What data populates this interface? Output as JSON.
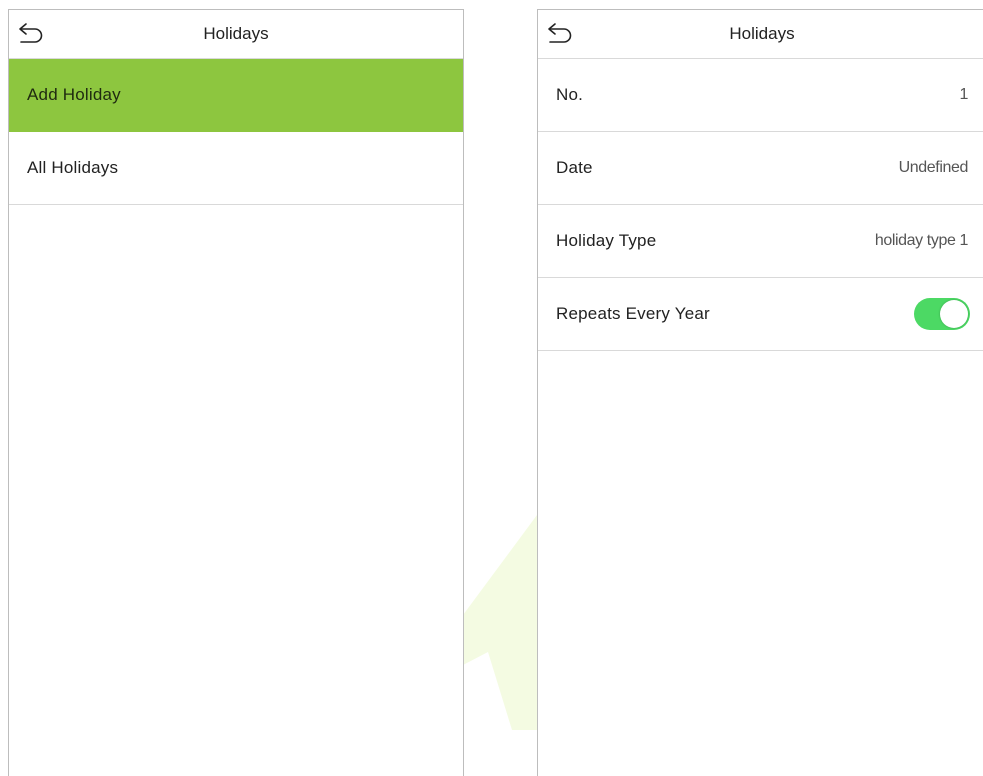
{
  "colors": {
    "accent_green": "#8dc63f",
    "toggle_on": "#4cd964",
    "arrow_watermark": "#f4fbe2",
    "border": "#bdbdbd"
  },
  "left_screen": {
    "header": {
      "back_icon": "back-arrow-icon",
      "title": "Holidays"
    },
    "menu_items": [
      {
        "label": "Add Holiday",
        "selected": true
      },
      {
        "label": "All Holidays",
        "selected": false
      }
    ]
  },
  "right_screen": {
    "header": {
      "back_icon": "back-arrow-icon",
      "title": "Holidays"
    },
    "fields": {
      "number": {
        "label": "No.",
        "value": "1"
      },
      "date": {
        "label": "Date",
        "value": "Undefined"
      },
      "holiday_type": {
        "label": "Holiday Type",
        "value": "holiday type 1"
      },
      "repeats_every_year": {
        "label": "Repeats Every Year",
        "enabled": true
      }
    }
  }
}
